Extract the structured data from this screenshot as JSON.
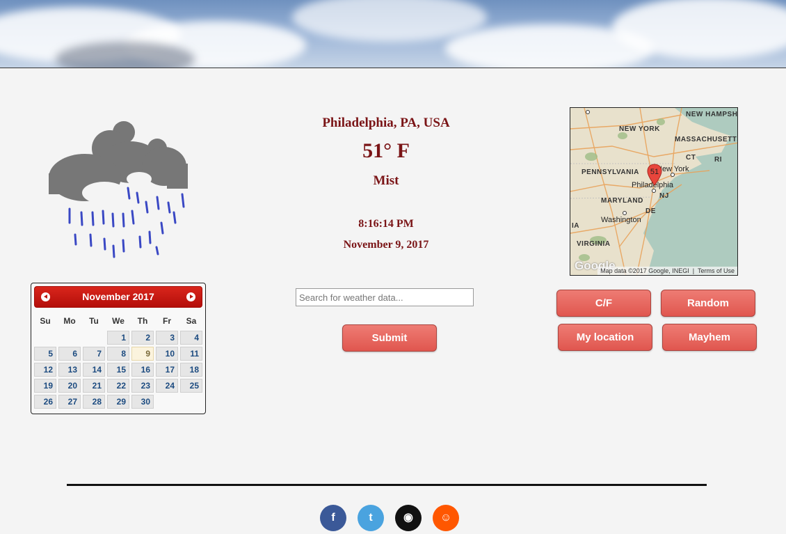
{
  "location": {
    "city": "Philadelphia, PA, USA",
    "temperature": "51° F",
    "condition": "Mist",
    "time": "8:16:14 PM",
    "date": "November 9, 2017"
  },
  "search": {
    "placeholder": "Search for weather data...",
    "value": ""
  },
  "buttons": {
    "submit": "Submit",
    "cf": "C/F",
    "random": "Random",
    "my_location": "My location",
    "mayhem": "Mayhem"
  },
  "calendar": {
    "month_label": "November 2017",
    "weekdays": [
      "Su",
      "Mo",
      "Tu",
      "We",
      "Th",
      "Fr",
      "Sa"
    ],
    "leading_blanks": 3,
    "days_in_month": 30,
    "today": 9
  },
  "map": {
    "marker_label": "51",
    "state_labels": [
      "NEW YORK",
      "NEW HAMPSHIRE",
      "MASSACHUSETTS",
      "PENNSYLVANIA",
      "CT",
      "RI",
      "NJ",
      "MARYLAND",
      "DE",
      "VIRGINIA",
      "IA"
    ],
    "city_labels": [
      "New York",
      "Philadelphia",
      "Washington"
    ],
    "attribution": "Map data ©2017 Google, INEGI",
    "terms": "Terms of Use",
    "logo": "Google"
  },
  "social": [
    {
      "icon": "facebook-icon",
      "glyph": "f",
      "color": "#3b5998"
    },
    {
      "icon": "twitter-icon",
      "glyph": "t",
      "color": "#4aa3df"
    },
    {
      "icon": "github-icon",
      "glyph": "◉",
      "color": "#111111"
    },
    {
      "icon": "reddit-icon",
      "glyph": "☺",
      "color": "#ff5700"
    }
  ],
  "colors": {
    "accent": "#7a1416",
    "button": "#e4625a",
    "calendar_header": "#c8170f",
    "rain": "#3a48c4"
  }
}
